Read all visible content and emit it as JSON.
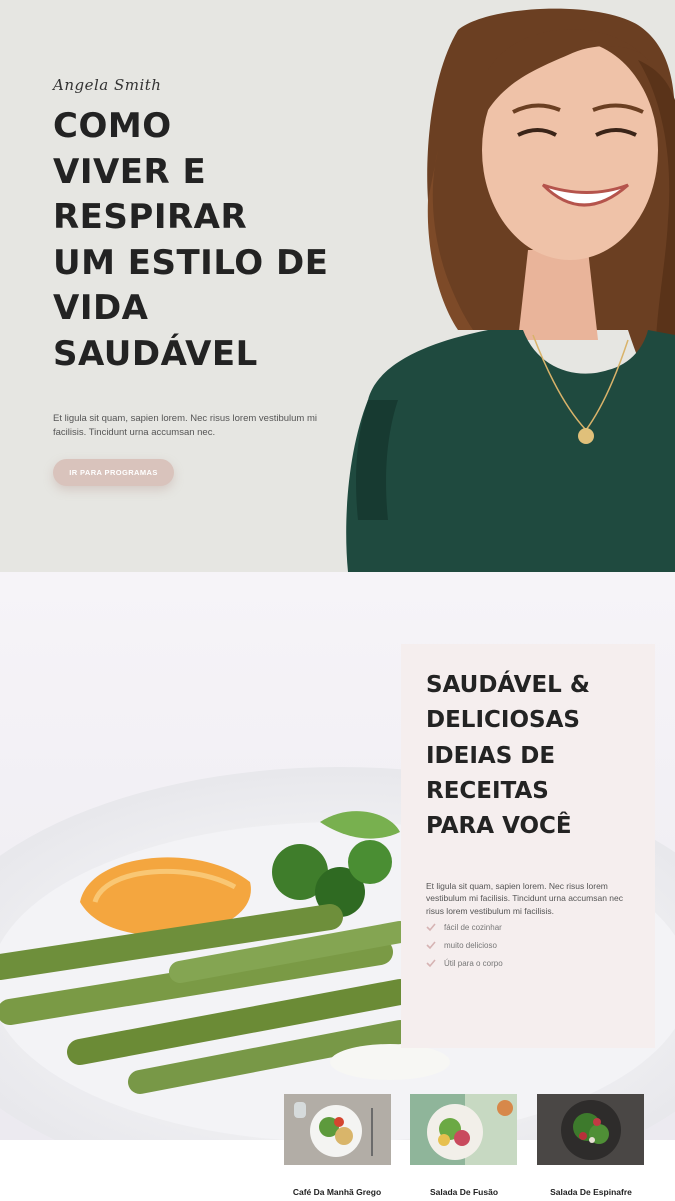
{
  "hero": {
    "signature": "Angela Smith",
    "title_lines": [
      "COMO",
      "VIVER E",
      "RESPIRAR",
      "UM ESTILO DE",
      "VIDA",
      "SAUDÁVEL"
    ],
    "description": "Et ligula sit quam, sapien lorem. Nec risus lorem vestibulum mi facilisis. Tincidunt urna accumsan nec.",
    "cta_label": "IR PARA PROGRAMAS"
  },
  "recipes": {
    "title_lines": [
      "SAUDÁVEL &",
      "DELICIOSAS",
      "IDEIAS DE",
      "RECEITAS",
      "PARA VOCÊ"
    ],
    "description": "Et ligula sit quam, sapien lorem. Nec risus lorem vestibulum mi facilisis. Tincidunt urna accumsan nec risus lorem vestibulum mi facilisis.",
    "features": [
      "fácil de cozinhar",
      "muito delicioso",
      "Útil para o corpo"
    ],
    "check_icon": "check-icon",
    "check_color": "#d6b3b3"
  },
  "thumbnails": [
    {
      "label": "Café Da Manhã Grego"
    },
    {
      "label": "Salada De Fusão"
    },
    {
      "label": "Salada De Espinafre"
    }
  ],
  "colors": {
    "hero_bg": "#e6e6e2",
    "cta_bg": "#d9c3bc",
    "card_bg": "#f5eeee",
    "text_dark": "#232323"
  }
}
